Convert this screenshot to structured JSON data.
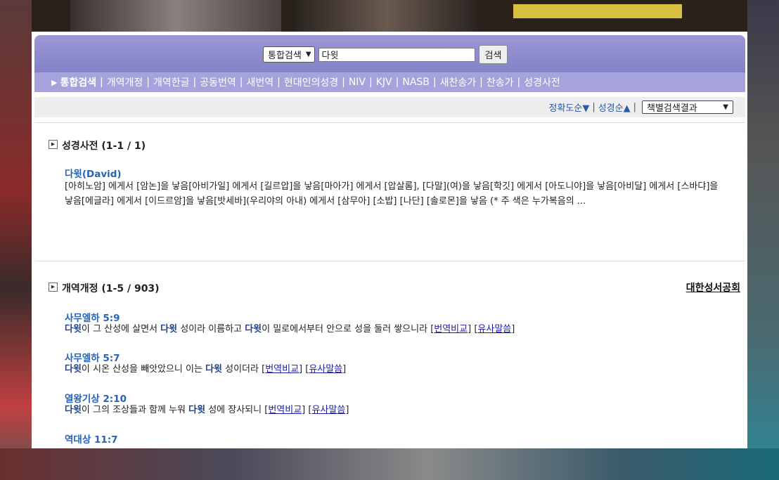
{
  "search": {
    "scope_selected": "통합검색",
    "query": "다윗",
    "button_label": "검색"
  },
  "nav": {
    "items": [
      {
        "label": "통합검색",
        "active": true
      },
      {
        "label": "개역개정"
      },
      {
        "label": "개역한글"
      },
      {
        "label": "공동번역"
      },
      {
        "label": "새번역"
      },
      {
        "label": "현대인의성경"
      },
      {
        "label": "NIV"
      },
      {
        "label": "KJV"
      },
      {
        "label": "NASB"
      },
      {
        "label": "새찬송가"
      },
      {
        "label": "찬송가"
      },
      {
        "label": "성경사전"
      }
    ]
  },
  "sort": {
    "accuracy": "정확도순▼",
    "bible_order": "성경순▲",
    "result_view": "책별검색결과"
  },
  "dictionary": {
    "heading": "성경사전 (1-1 / 1)",
    "entry_title": "다윗(David)",
    "entry_text": "[아히노암] 에게서 [암논]을 낳음[아비가일] 에게서 [길르압]을 낳음[마아가] 에게서 [압살롬], [다말](여)을 낳음[학깃] 에게서 [아도니야]을 낳음[아비달] 에게서 [스바댜]을 낳음[에글라] 에게서 [이드르암]을 낳음[밧세바](우리야의 아내) 에게서 [삼무아] [소밥] [나단] [솔로몬]을 낳음 (* 주 색은 누가복음의 ..."
  },
  "revised": {
    "heading": "개역개정 (1-5 / 903)",
    "publisher": "대한성서공회",
    "results": [
      {
        "ref": "사무엘하 5:9",
        "parts": [
          [
            "다윗",
            true
          ],
          [
            "이 그 산성에 살면서 ",
            false
          ],
          [
            "다윗",
            true
          ],
          [
            " 성이라 이름하고 ",
            false
          ],
          [
            "다윗",
            true
          ],
          [
            "이 밀로에서부터 안으로 성을 둘러 쌓으니라 ",
            false
          ]
        ]
      },
      {
        "ref": "사무엘하 5:7",
        "parts": [
          [
            "다윗",
            true
          ],
          [
            "이 시온 산성을 빼앗았으니 이는 ",
            false
          ],
          [
            "다윗",
            true
          ],
          [
            " 성이더라 ",
            false
          ]
        ]
      },
      {
        "ref": "열왕기상 2:10",
        "parts": [
          [
            "다윗",
            true
          ],
          [
            "이 그의 조상들과 함께 누워 ",
            false
          ],
          [
            "다윗",
            true
          ],
          [
            " 성에 장사되니 ",
            false
          ]
        ]
      },
      {
        "ref": "역대상 11:7",
        "parts": []
      }
    ],
    "compare_label": "번역비교",
    "similar_label": "유사말씀"
  }
}
